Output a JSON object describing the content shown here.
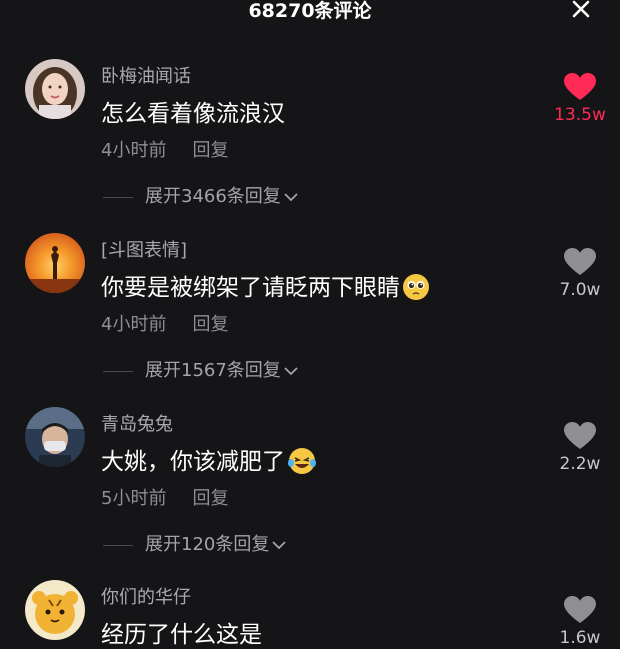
{
  "header": {
    "title": "68270条评论",
    "close_icon": "close-icon"
  },
  "comments": [
    {
      "username": "卧梅油闻话",
      "text": "怎么看着像流浪汉",
      "time": "4小时前",
      "reply_label": "回复",
      "likes": "13.5w",
      "liked": true,
      "expand": "展开3466条回复",
      "avatar": "woman-portrait"
    },
    {
      "username": "[斗图表情]",
      "text": "你要是被绑架了请眨两下眼睛",
      "emoji": "pleading-face",
      "time": "4小时前",
      "reply_label": "回复",
      "likes": "7.0w",
      "liked": false,
      "expand": "展开1567条回复",
      "avatar": "sunset-silhouette"
    },
    {
      "username": "青岛兔兔",
      "text": "大姚，你该减肥了",
      "emoji": "laughing-tears-face",
      "time": "5小时前",
      "reply_label": "回复",
      "likes": "2.2w",
      "liked": false,
      "expand": "展开120条回复",
      "avatar": "man-with-mask"
    },
    {
      "username": "你们的华仔",
      "text": "经历了什么这是",
      "likes": "1.6w",
      "liked": false,
      "avatar": "cartoon-tiger"
    }
  ],
  "colors": {
    "background": "#151517",
    "like_active": "#ff2a55",
    "like_inactive": "#8e8e93"
  }
}
